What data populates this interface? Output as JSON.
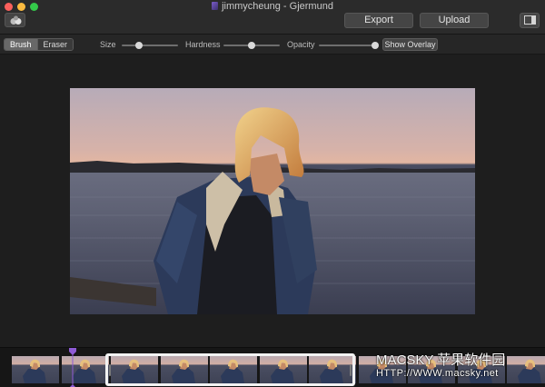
{
  "window": {
    "title": "jimmycheung - Gjermund"
  },
  "toolbar_top": {
    "export_label": "Export",
    "upload_label": "Upload"
  },
  "tools": {
    "mode_buttons": [
      "Brush",
      "Eraser"
    ],
    "active_mode": "Brush",
    "size_label": "Size",
    "hardness_label": "Hardness",
    "opacity_label": "Opacity",
    "size_value": 0.3,
    "hardness_value": 0.5,
    "opacity_value": 1.0,
    "show_overlay_label": "Show Overlay"
  },
  "filmstrip": {
    "frame_count": 11,
    "playhead_color": "#8e5bd6",
    "selection_color": "#f2f2f2"
  },
  "watermark": {
    "line1": "MACSKY 苹果软件园",
    "line2": "HTTP://WWW.macsky.net"
  },
  "colors": {
    "window_bg": "#1e1e1e",
    "titlebar_bg": "#2b2b2b",
    "button_bg": "#454545",
    "close": "#fc605c",
    "minimize": "#fcbb40",
    "maximize": "#34c84a"
  }
}
